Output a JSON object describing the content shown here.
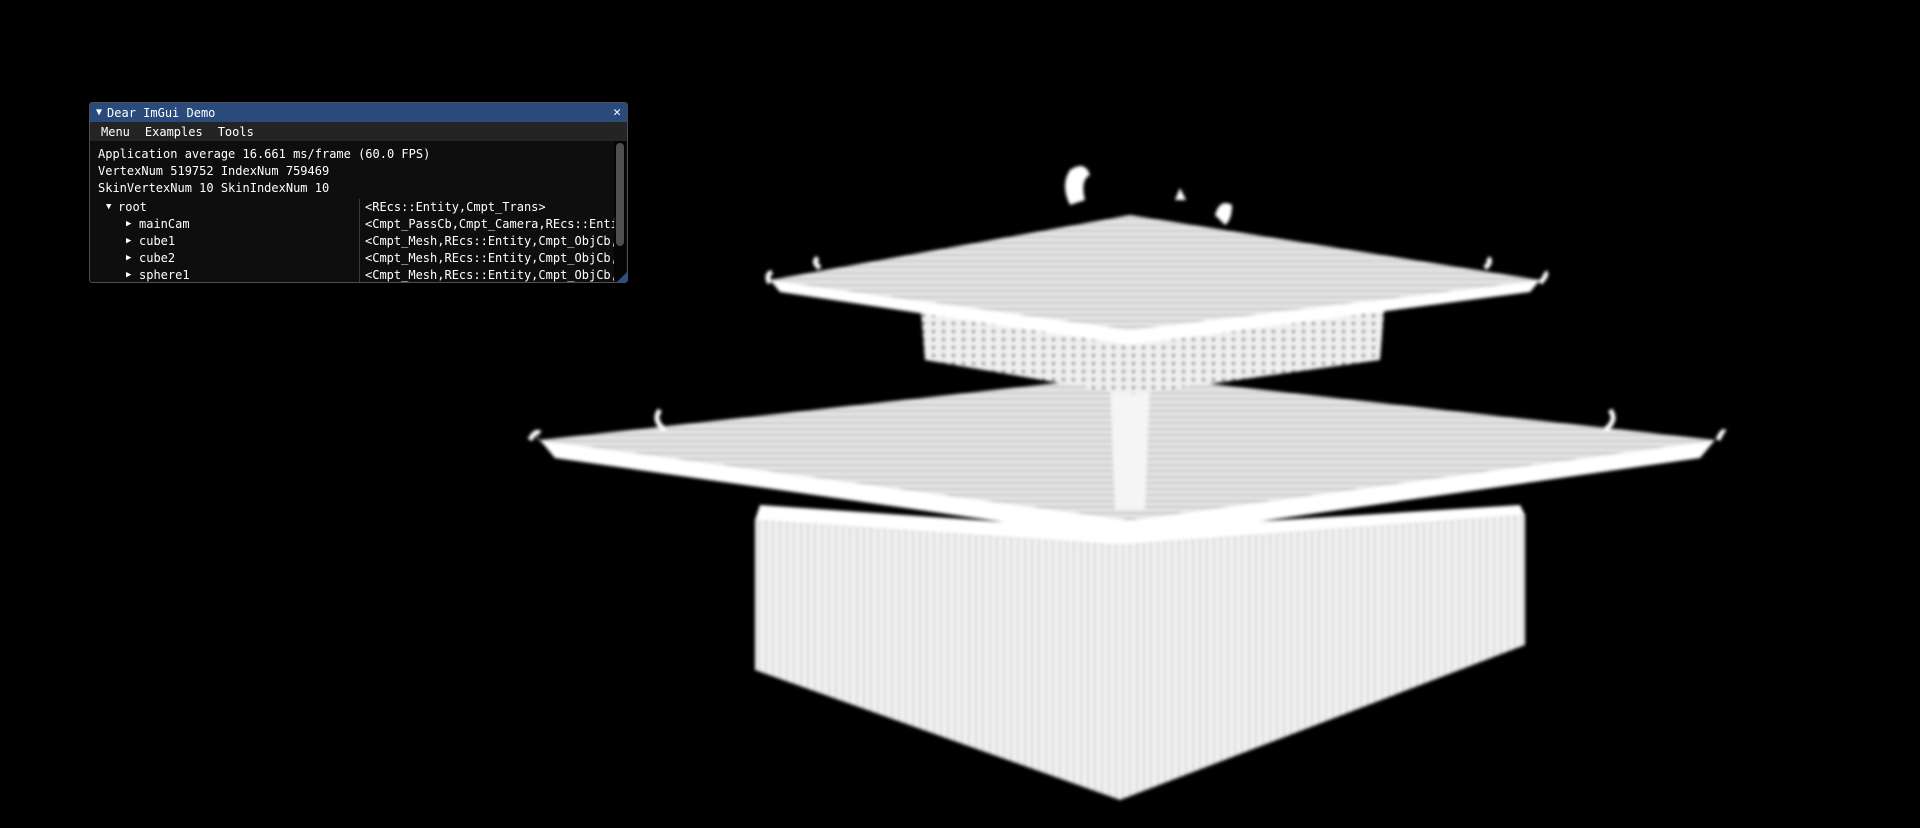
{
  "window": {
    "title": "Dear ImGui Demo",
    "collapse_icon": "triangle-down-icon",
    "close_icon": "close-icon",
    "title_bar_color": "#294a7a"
  },
  "menubar": {
    "items": [
      "Menu",
      "Examples",
      "Tools"
    ]
  },
  "stats": {
    "fps_line": "Application average 16.661 ms/frame (60.0 FPS)",
    "vertex_line": "VertexNum 519752 IndexNum 759469",
    "skin_line": "SkinVertexNum 10 SkinIndexNum 10"
  },
  "tree": {
    "root": {
      "label": "root",
      "components": "<REcs::Entity,Cmpt_Trans>",
      "expanded": true
    },
    "children": [
      {
        "label": "mainCam",
        "components": "<Cmpt_PassCb,Cmpt_Camera,REcs::Entity,Cmpt_Trans>"
      },
      {
        "label": "cube1",
        "components": "<Cmpt_Mesh,REcs::Entity,Cmpt_ObjCb,Cmpt_Trans>"
      },
      {
        "label": "cube2",
        "components": "<Cmpt_Mesh,REcs::Entity,Cmpt_ObjCb,Cmpt_Trans>"
      },
      {
        "label": "sphere1",
        "components": "<Cmpt_Mesh,REcs::Entity,Cmpt_ObjCb,Cmpt_Trans>"
      }
    ]
  },
  "scene": {
    "description_icon": "pagoda-model",
    "background": "#000000"
  }
}
